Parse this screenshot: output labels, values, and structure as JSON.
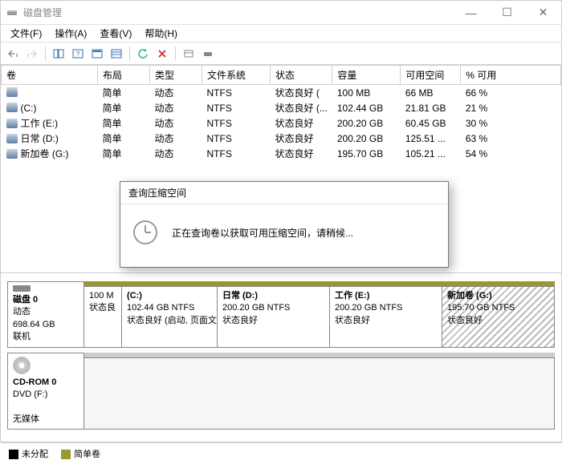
{
  "window": {
    "title": "磁盘管理",
    "min": "—",
    "max": "☐",
    "close": "✕"
  },
  "menu": {
    "file": "文件(F)",
    "action": "操作(A)",
    "view": "查看(V)",
    "help": "帮助(H)"
  },
  "columns": {
    "vol": "卷",
    "layout": "布局",
    "type": "类型",
    "fs": "文件系统",
    "status": "状态",
    "capacity": "容量",
    "free": "可用空间",
    "pctfree": "% 可用"
  },
  "rows": [
    {
      "vol": "",
      "layout": "简单",
      "type": "动态",
      "fs": "NTFS",
      "status": "状态良好 (",
      "capacity": "100 MB",
      "free": "66 MB",
      "pct": "66 %"
    },
    {
      "vol": "(C:)",
      "layout": "简单",
      "type": "动态",
      "fs": "NTFS",
      "status": "状态良好 (...",
      "capacity": "102.44 GB",
      "free": "21.81 GB",
      "pct": "21 %"
    },
    {
      "vol": "工作 (E:)",
      "layout": "简单",
      "type": "动态",
      "fs": "NTFS",
      "status": "状态良好",
      "capacity": "200.20 GB",
      "free": "60.45 GB",
      "pct": "30 %"
    },
    {
      "vol": "日常 (D:)",
      "layout": "简单",
      "type": "动态",
      "fs": "NTFS",
      "status": "状态良好",
      "capacity": "200.20 GB",
      "free": "125.51 ...",
      "pct": "63 %"
    },
    {
      "vol": "新加卷 (G:)",
      "layout": "简单",
      "type": "动态",
      "fs": "NTFS",
      "status": "状态良好",
      "capacity": "195.70 GB",
      "free": "105.21 ...",
      "pct": "54 %"
    }
  ],
  "dialog": {
    "title": "查询压缩空间",
    "message": "正在查询卷以获取可用压缩空间，请稍候..."
  },
  "disk0": {
    "title": "磁盘 0",
    "kind": "动态",
    "size": "698.64 GB",
    "state": "联机",
    "p1_l1": "100 M",
    "p1_l2": "状态良",
    "p2_l1": "(C:)",
    "p2_l2": "102.44 GB NTFS",
    "p2_l3": "状态良好 (启动, 页面文",
    "p3_l1": "日常   (D:)",
    "p3_l2": "200.20 GB NTFS",
    "p3_l3": "状态良好",
    "p4_l1": "工作   (E:)",
    "p4_l2": "200.20 GB NTFS",
    "p4_l3": "状态良好",
    "p5_l1": "新加卷   (G:)",
    "p5_l2": "195.70 GB NTFS",
    "p5_l3": "状态良好"
  },
  "cdrom": {
    "title": "CD-ROM 0",
    "kind": "DVD (F:)",
    "state": "无媒体"
  },
  "legend": {
    "unalloc": "未分配",
    "simple": "简单卷"
  }
}
